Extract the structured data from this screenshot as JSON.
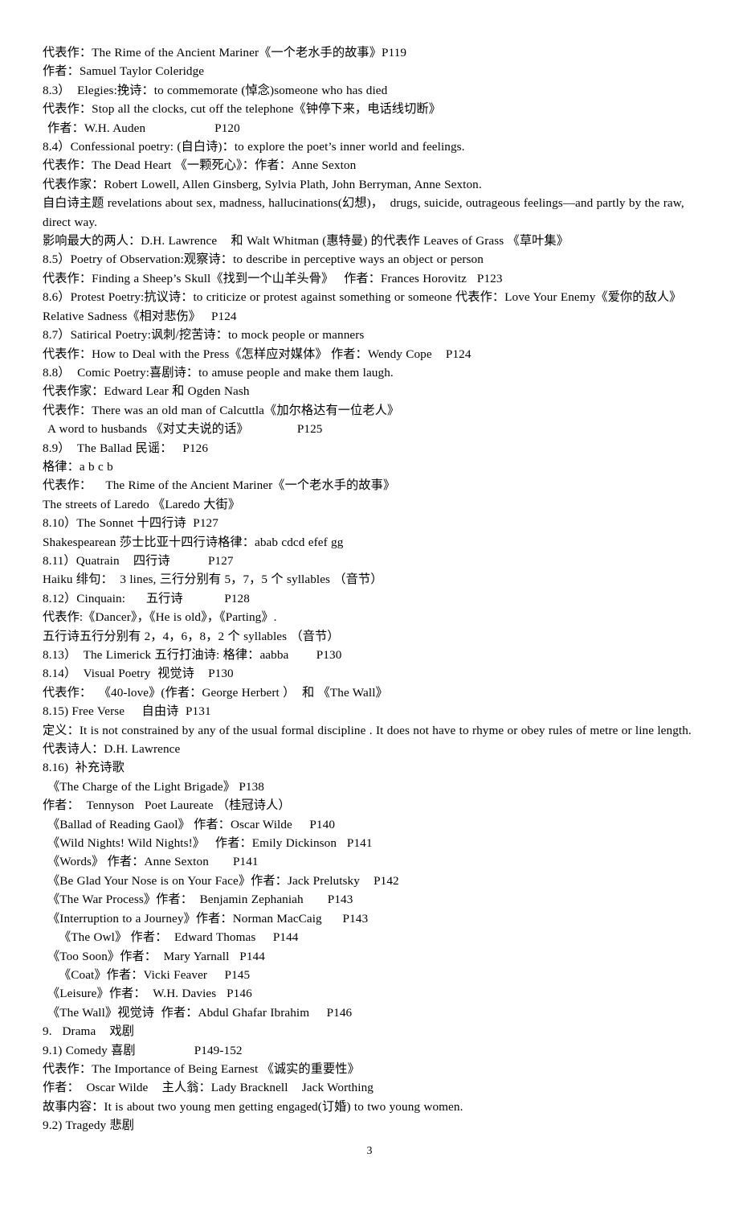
{
  "document": {
    "page_number": "3",
    "background_color": "#ffffff",
    "text_color": "#000000",
    "lines": [
      {
        "indent": 0,
        "text": "代表作：The Rime of the Ancient Mariner《一个老水手的故事》P119"
      },
      {
        "indent": 0,
        "text": "作者：Samuel Taylor Coleridge"
      },
      {
        "indent": 0,
        "text": "8.3）  Elegies:挽诗：to commemorate (悼念)someone who has died"
      },
      {
        "indent": 0,
        "text": "代表作：Stop all the clocks, cut off the telephone《钟停下来，电话线切断》"
      },
      {
        "indent": 1,
        "text": "作者：W.H. Auden                    P120"
      },
      {
        "indent": 0,
        "text": "8.4）Confessional poetry: (自白诗)：to explore the poet’s inner world and feelings."
      },
      {
        "indent": 0,
        "text": "代表作：The Dead Heart 《一颗死心》：作者：Anne Sexton"
      },
      {
        "indent": 0,
        "text": "代表作家：Robert Lowell, Allen Ginsberg, Sylvia Plath, John Berryman, Anne Sexton."
      },
      {
        "indent": 0,
        "text": "自白诗主题 revelations about sex, madness, hallucinations(幻想)，  drugs, suicide, outrageous feelings—and partly by the raw, direct way."
      },
      {
        "indent": 0,
        "text": "影响最大的两人：D.H. Lawrence    和 Walt Whitman (惠特曼) 的代表作 Leaves of Grass 《草叶集》"
      },
      {
        "indent": 0,
        "text": "8.5）Poetry of Observation:观察诗：to describe in perceptive ways an object or person"
      },
      {
        "indent": 0,
        "text": "代表作：Finding a Sheep’s Skull《找到一个山羊头骨》   作者：Frances Horovitz   P123"
      },
      {
        "indent": 0,
        "text": "8.6）Protest Poetry:抗议诗：to criticize or protest against something or someone 代表作：Love Your Enemy《爱你的敌人》Relative Sadness《相对悲伤》   P124"
      },
      {
        "indent": 0,
        "text": "8.7）Satirical Poetry:讽刺/挖苦诗：to mock people or manners"
      },
      {
        "indent": 0,
        "text": "代表作：How to Deal with the Press《怎样应对媒体》 作者：Wendy Cope    P124"
      },
      {
        "indent": 0,
        "text": "8.8）  Comic Poetry:喜剧诗：to amuse people and make them laugh."
      },
      {
        "indent": 0,
        "text": "代表作家：Edward Lear 和 Ogden Nash"
      },
      {
        "indent": 0,
        "text": "代表作：There was an old man of Calcuttla《加尔格达有一位老人》"
      },
      {
        "indent": 1,
        "text": "A word to husbands 《对丈夫说的话》              P125"
      },
      {
        "indent": 0,
        "text": "8.9）  The Ballad 民谣：   P126"
      },
      {
        "indent": 0,
        "text": "格律：a b c b"
      },
      {
        "indent": 0,
        "text": "代表作：    The Rime of the Ancient Mariner《一个老水手的故事》"
      },
      {
        "indent": 0,
        "text": "The streets of Laredo 《Laredo 大街》"
      },
      {
        "indent": 0,
        "text": "8.10）The Sonnet 十四行诗  P127"
      },
      {
        "indent": 0,
        "text": "Shakespearean 莎士比亚十四行诗格律：abab cdcd efef gg"
      },
      {
        "indent": 0,
        "text": "8.11）Quatrain    四行诗           P127"
      },
      {
        "indent": 0,
        "text": "Haiku 绯句：  3 lines, 三行分别有 5，7，5 个 syllables （音节）"
      },
      {
        "indent": 0,
        "text": "8.12）Cinquain:      五行诗            P128"
      },
      {
        "indent": 0,
        "text": "代表作:《Dancer》，《He is old》，《Parting》."
      },
      {
        "indent": 0,
        "text": "五行诗五行分别有 2，4，6，8，2 个 syllables （音节）"
      },
      {
        "indent": 0,
        "text": "8.13）  The Limerick 五行打油诗: 格律：aabba        P130"
      },
      {
        "indent": 0,
        "text": "8.14）  Visual Poetry  视觉诗    P130"
      },
      {
        "indent": 0,
        "text": "代表作：  《40-love》(作者：George Herbert ）  和 《The Wall》"
      },
      {
        "indent": 0,
        "text": "8.15) Free Verse     自由诗  P131"
      },
      {
        "indent": 0,
        "text": "定义：It is not constrained by any of the usual formal discipline . It does not have to rhyme or obey rules of metre or line length."
      },
      {
        "indent": 0,
        "text": "代表诗人：D.H. Lawrence"
      },
      {
        "indent": 0,
        "text": "8.16)  补充诗歌"
      },
      {
        "indent": 1,
        "text": "《The Charge of the Light Brigade》 P138"
      },
      {
        "indent": 0,
        "text": "作者：  Tennyson   Poet Laureate （桂冠诗人）"
      },
      {
        "indent": 1,
        "text": "《Ballad of Reading Gaol》 作者：Oscar Wilde     P140"
      },
      {
        "indent": 1,
        "text": "《Wild Nights! Wild Nights!》   作者：Emily Dickinson   P141"
      },
      {
        "indent": 1,
        "text": "《Words》 作者：Anne Sexton       P141"
      },
      {
        "indent": 1,
        "text": "《Be Glad Your Nose is on Your Face》作者：Jack Prelutsky    P142"
      },
      {
        "indent": 1,
        "text": "《The War Process》作者：  Benjamin Zephaniah       P143"
      },
      {
        "indent": 1,
        "text": "《Interruption to a Journey》作者：Norman MacCaig      P143"
      },
      {
        "indent": 3,
        "text": "《The Owl》 作者：  Edward Thomas     P144"
      },
      {
        "indent": 1,
        "text": "《Too Soon》作者：  Mary Yarnall   P144"
      },
      {
        "indent": 3,
        "text": "《Coat》作者：Vicki Feaver     P145"
      },
      {
        "indent": 1,
        "text": "《Leisure》作者：  W.H. Davies   P146"
      },
      {
        "indent": 1,
        "text": "《The Wall》视觉诗  作者：Abdul Ghafar Ibrahim     P146"
      },
      {
        "indent": 0,
        "text": "9.   Drama    戏剧"
      },
      {
        "indent": 0,
        "text": "9.1) Comedy 喜剧                 P149-152"
      },
      {
        "indent": 0,
        "text": "代表作：The Importance of Being Earnest 《诚实的重要性》"
      },
      {
        "indent": 0,
        "text": "作者：  Oscar Wilde    主人翁：Lady Bracknell    Jack Worthing"
      },
      {
        "indent": 0,
        "text": "故事内容：It is about two young men getting engaged(订婚) to two young women."
      },
      {
        "indent": 0,
        "text": "9.2) Tragedy 悲剧"
      }
    ]
  }
}
